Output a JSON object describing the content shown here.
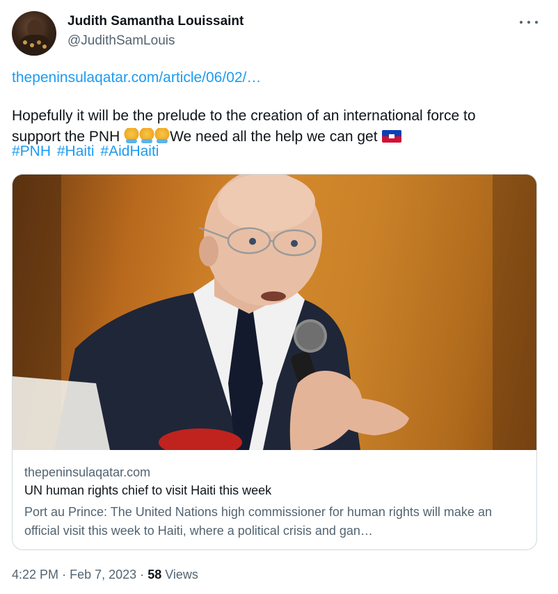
{
  "author": {
    "name": "Judith Samantha Louissaint",
    "handle": "@JudithSamLouis"
  },
  "tweet": {
    "link": "thepeninsulaqatar.com/article/06/02/…",
    "text_line1": "Hopefully it will be the prelude to the creation of an international force to",
    "text_line2": "support the PNH ",
    "text_line2_after": "We need all the help we can get",
    "emojis": [
      "folded-hands-emoji",
      "folded-hands-emoji",
      "folded-hands-emoji",
      "haiti-flag-emoji"
    ],
    "hashtags": [
      "#PNH",
      "#Haiti",
      "#AidHaiti"
    ]
  },
  "card": {
    "domain": "thepeninsulaqatar.com",
    "title": "UN human rights chief to visit Haiti this week",
    "description": "Port au Prince: The United Nations high commissioner for human rights will make an official visit this week to Haiti, where a political crisis and gan…"
  },
  "meta": {
    "time": "4:22 PM",
    "separator": "·",
    "date": "Feb 7, 2023",
    "views_count": "58",
    "views_label": "Views"
  },
  "colors": {
    "link": "#1d9bf0",
    "text": "#0f1419",
    "secondary": "#536471",
    "border": "#cfd9de"
  },
  "icons": {
    "more": "more-horizontal-icon"
  }
}
